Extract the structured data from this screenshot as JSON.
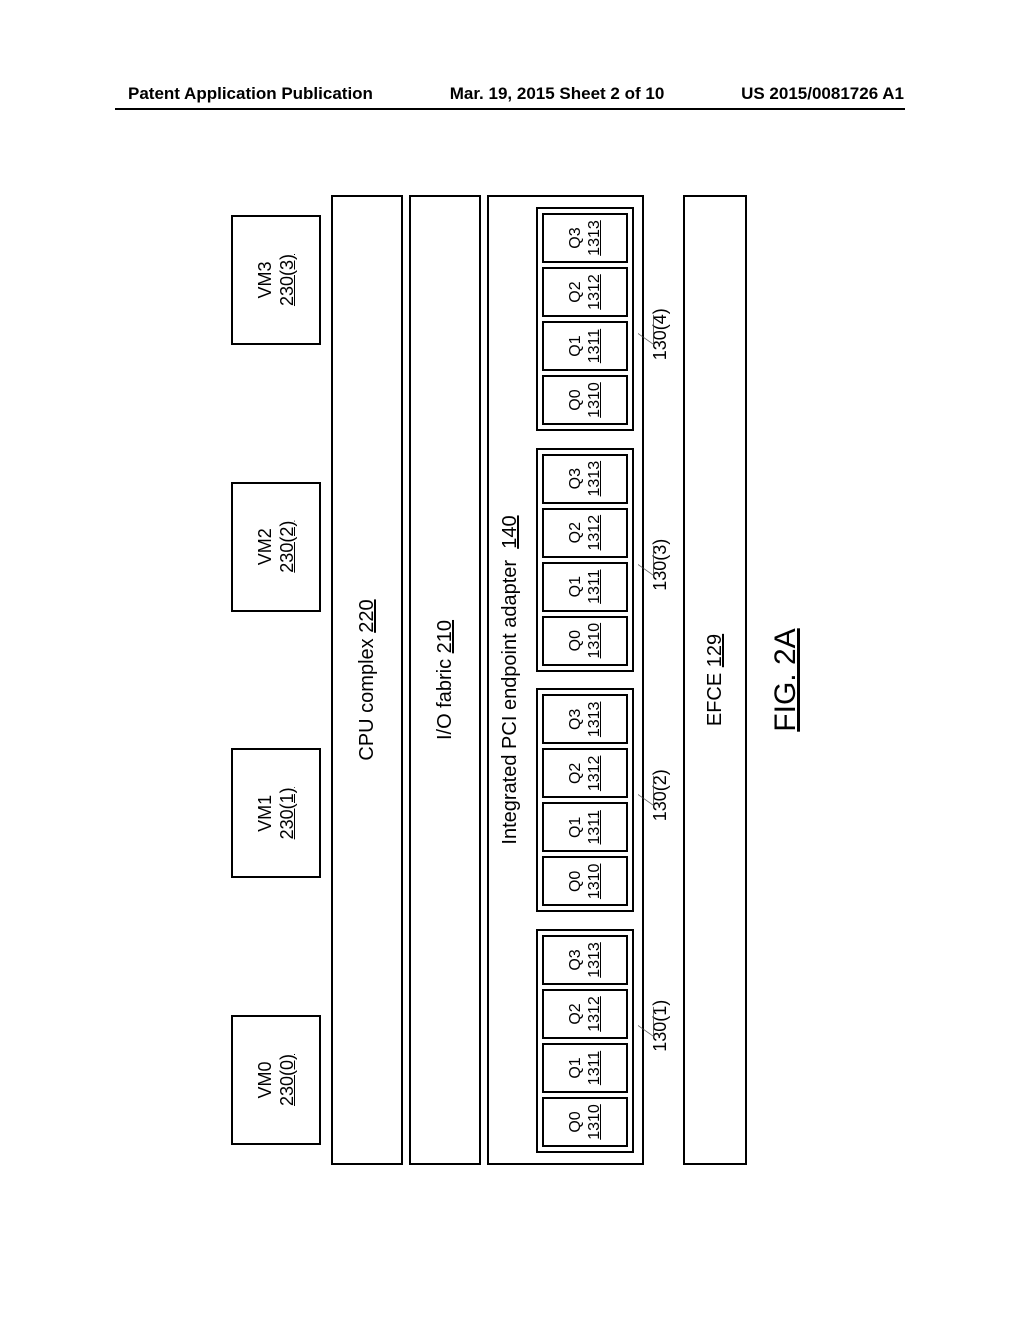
{
  "header": {
    "left": "Patent Application Publication",
    "center": "Mar. 19, 2015  Sheet 2 of 10",
    "right": "US 2015/0081726 A1"
  },
  "vms": [
    {
      "name": "VM0",
      "ref": "230(0)"
    },
    {
      "name": "VM1",
      "ref": "230(1)"
    },
    {
      "name": "VM2",
      "ref": "230(2)"
    },
    {
      "name": "VM3",
      "ref": "230(3)"
    }
  ],
  "cpu": {
    "label": "CPU complex",
    "ref": "220"
  },
  "io": {
    "label": "I/O fabric",
    "ref": "210"
  },
  "adapter": {
    "label": "Integrated PCI endpoint adapter",
    "ref": "140"
  },
  "queues": [
    {
      "name": "Q0",
      "ref": "1310"
    },
    {
      "name": "Q1",
      "ref": "1311"
    },
    {
      "name": "Q2",
      "ref": "1312"
    },
    {
      "name": "Q3",
      "ref": "1313"
    }
  ],
  "vnic_refs": [
    "130(1)",
    "130(2)",
    "130(3)",
    "130(4)"
  ],
  "efce": {
    "label": "EFCE",
    "ref": "129"
  },
  "figure": "FIG. 2A"
}
